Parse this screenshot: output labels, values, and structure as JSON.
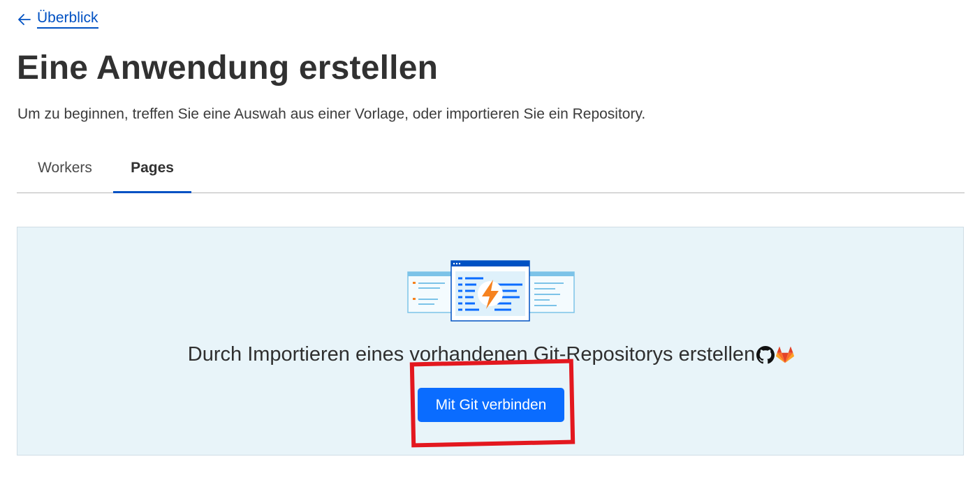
{
  "nav": {
    "back_label": "Überblick"
  },
  "header": {
    "title": "Eine Anwendung erstellen",
    "subtitle": "Um zu beginnen, treffen Sie eine Auswah aus einer Vorlage, oder importieren Sie ein Repository."
  },
  "tabs": [
    {
      "label": "Workers",
      "active": false
    },
    {
      "label": "Pages",
      "active": true
    }
  ],
  "import_panel": {
    "text": "Durch Importieren eines vorhandenen Git-Repositorys erstellen",
    "icons": [
      "github-icon",
      "gitlab-icon"
    ],
    "button_label": "Mit Git verbinden"
  },
  "colors": {
    "accent": "#0051c3",
    "button": "#0a6cff",
    "panel_bg": "#e8f4f9",
    "highlight": "#e3181f",
    "bolt": "#f6821f"
  }
}
